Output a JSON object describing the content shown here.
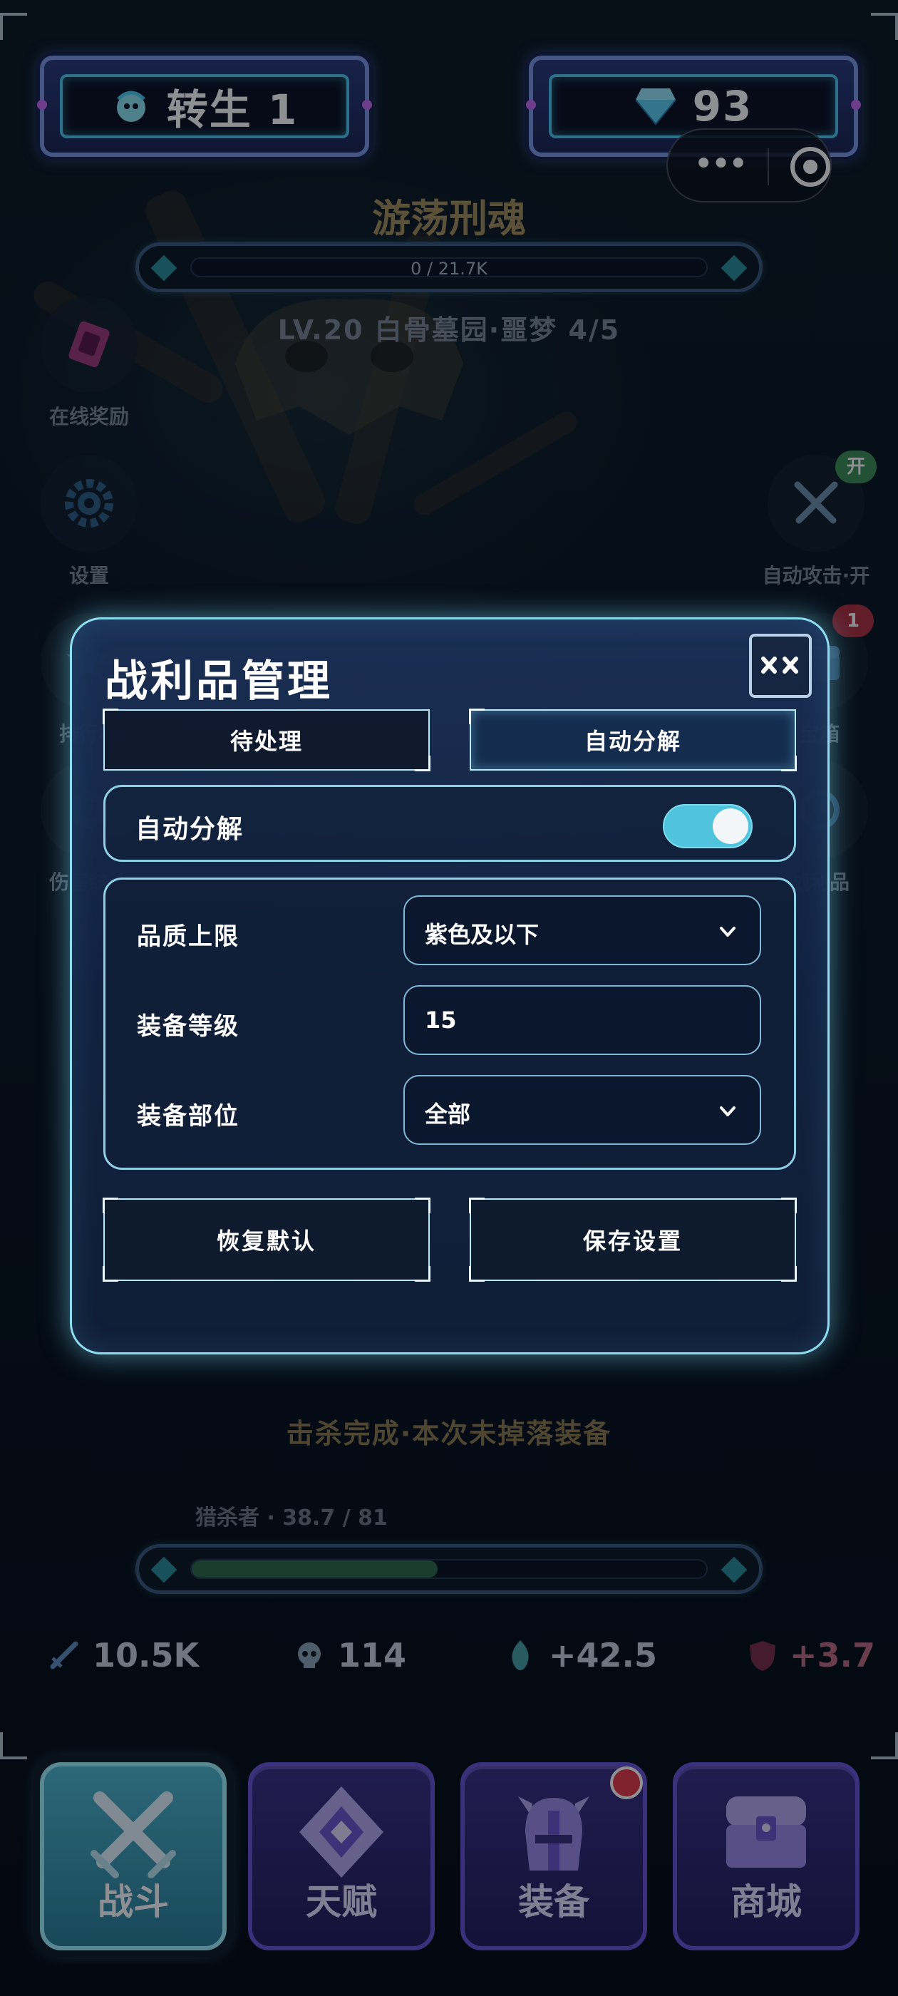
{
  "header": {
    "rebirth_label": "转生 1",
    "gems": "93"
  },
  "boss": {
    "name": "游荡刑魂",
    "hp_text": "0 / 21.7K",
    "hp_fraction": 0,
    "stage": "LV.20 白骨墓园·噩梦 4/5"
  },
  "side_left": [
    {
      "label": "在线奖励",
      "icon": "reward-card-icon"
    },
    {
      "label": "设置",
      "icon": "gear-icon"
    },
    {
      "label": "排行榜",
      "icon": "leaderboard-icon"
    },
    {
      "label": "伤害统计",
      "icon": "damage-stats-icon"
    }
  ],
  "side_right": [
    {
      "label": "自动攻击·开",
      "icon": "crossed-swords-icon",
      "pill": "开"
    },
    {
      "label": "宝箱",
      "icon": "chest-icon",
      "pill": "1"
    },
    {
      "label": "战利品",
      "icon": "loot-icon"
    }
  ],
  "modal": {
    "title": "战利品管理",
    "tabs": [
      {
        "label": "待处理",
        "active": false
      },
      {
        "label": "自动分解",
        "active": true
      }
    ],
    "toggle_label": "自动分解",
    "toggle_on": true,
    "fields": [
      {
        "label": "品质上限",
        "value": "紫色及以下",
        "type": "select"
      },
      {
        "label": "装备等级",
        "value": "15",
        "type": "input"
      },
      {
        "label": "装备部位",
        "value": "全部",
        "type": "select"
      }
    ],
    "buttons": {
      "reset": "恢复默认",
      "save": "保存设置"
    }
  },
  "battle": {
    "kill_message": "击杀完成·本次未掉落装备",
    "hunter_label": "猎杀者 · 38.7 / 81",
    "hunter_fraction": 0.478
  },
  "stats": [
    {
      "icon": "sword-icon",
      "value": "10.5K",
      "color": "#d7e0ea"
    },
    {
      "icon": "skull-icon",
      "value": "114",
      "color": "#d7e0ea"
    },
    {
      "icon": "flame-spirit-icon",
      "value": "+42.5",
      "color": "#d7e0ea"
    },
    {
      "icon": "shield-heart-icon",
      "value": "+3.7",
      "color": "#e07a8f"
    }
  ],
  "nav": [
    {
      "label": "战斗",
      "active": true
    },
    {
      "label": "天赋",
      "active": false
    },
    {
      "label": "装备",
      "active": false,
      "dot": true
    },
    {
      "label": "商城",
      "active": false
    }
  ],
  "colors": {
    "accent": "#4fc4dc",
    "nav_purple": "#6a53d6",
    "gold_text": "#b59c62"
  }
}
